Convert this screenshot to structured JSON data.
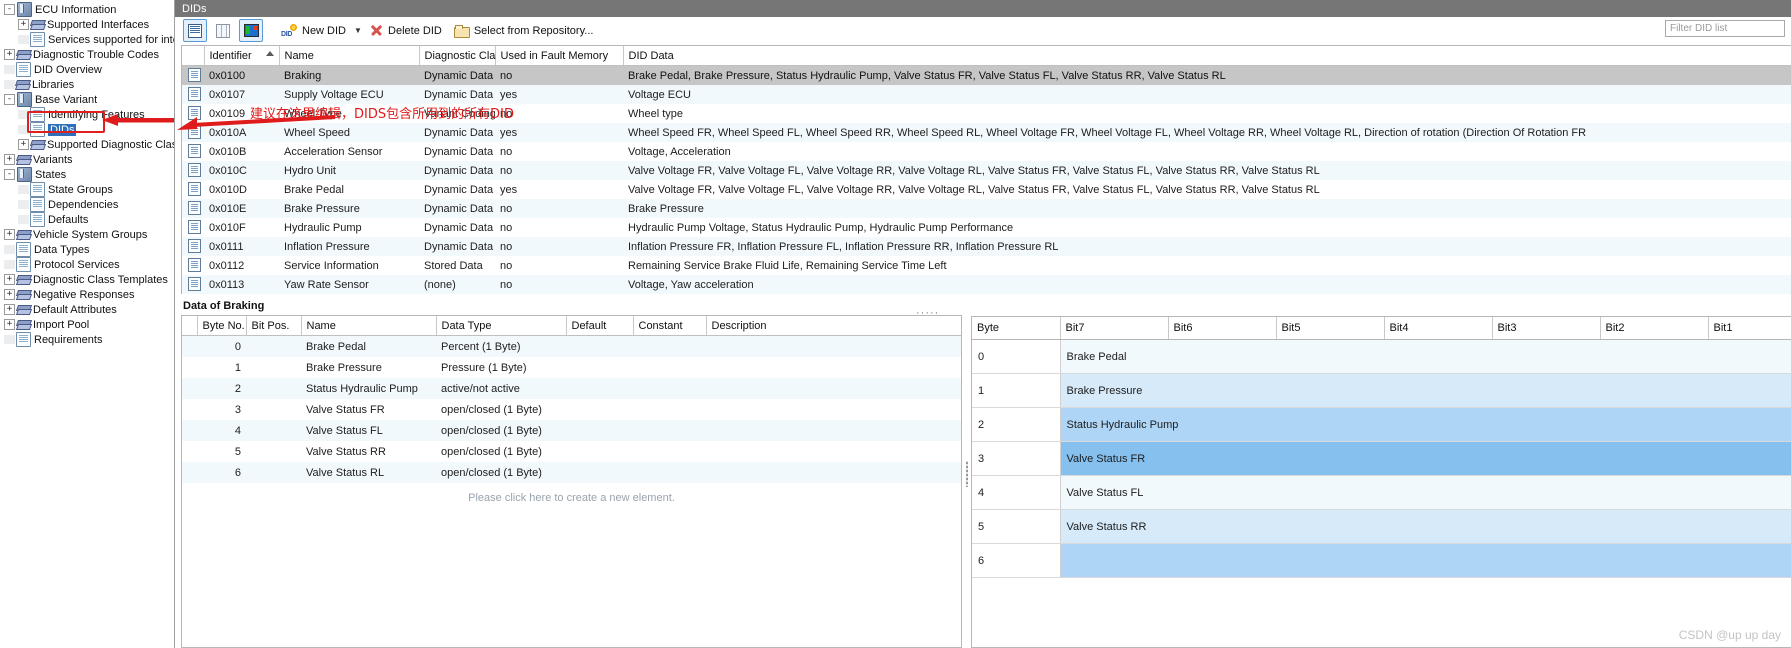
{
  "window": {
    "title": "DIDs"
  },
  "tree": {
    "items": [
      {
        "label": "ECU Information",
        "depth": 0,
        "icon": "book-icon",
        "expander": "-",
        "type": "book"
      },
      {
        "label": "Supported Interfaces",
        "depth": 1,
        "icon": "layer-icon",
        "expander": "+",
        "type": "layer"
      },
      {
        "label": "Services supported for interfa",
        "depth": 1,
        "icon": "page-icon",
        "expander": "",
        "type": "page"
      },
      {
        "label": "Diagnostic Trouble Codes",
        "depth": 0,
        "icon": "layer-icon",
        "expander": "+",
        "type": "layer"
      },
      {
        "label": "DID Overview",
        "depth": 0,
        "icon": "page-icon",
        "expander": "",
        "type": "page"
      },
      {
        "label": "Libraries",
        "depth": 0,
        "icon": "layer-icon",
        "expander": "",
        "type": "layer"
      },
      {
        "label": "Base Variant",
        "depth": 0,
        "icon": "book-icon",
        "expander": "-",
        "type": "book"
      },
      {
        "label": "Identifying Features",
        "depth": 1,
        "icon": "page-icon",
        "expander": "",
        "type": "page"
      },
      {
        "label": "DIDs",
        "depth": 1,
        "icon": "page-icon",
        "expander": "",
        "type": "page",
        "selected": true
      },
      {
        "label": "Supported Diagnostic Classes",
        "depth": 1,
        "icon": "layer-icon",
        "expander": "+",
        "type": "layer"
      },
      {
        "label": "Variants",
        "depth": 0,
        "icon": "layer-icon",
        "expander": "+",
        "type": "layer"
      },
      {
        "label": "States",
        "depth": 0,
        "icon": "book-icon",
        "expander": "-",
        "type": "book"
      },
      {
        "label": "State Groups",
        "depth": 1,
        "icon": "page-icon",
        "expander": "",
        "type": "page"
      },
      {
        "label": "Dependencies",
        "depth": 1,
        "icon": "page-icon",
        "expander": "",
        "type": "page"
      },
      {
        "label": "Defaults",
        "depth": 1,
        "icon": "page-icon",
        "expander": "",
        "type": "page"
      },
      {
        "label": "Vehicle System Groups",
        "depth": 0,
        "icon": "layer-icon",
        "expander": "+",
        "type": "layer"
      },
      {
        "label": "Data Types",
        "depth": 0,
        "icon": "page-icon",
        "expander": "",
        "type": "page"
      },
      {
        "label": "Protocol Services",
        "depth": 0,
        "icon": "page-icon",
        "expander": "",
        "type": "page"
      },
      {
        "label": "Diagnostic Class Templates",
        "depth": 0,
        "icon": "layer-icon",
        "expander": "+",
        "type": "layer"
      },
      {
        "label": "Negative Responses",
        "depth": 0,
        "icon": "layer-icon",
        "expander": "+",
        "type": "layer"
      },
      {
        "label": "Default Attributes",
        "depth": 0,
        "icon": "layer-icon",
        "expander": "+",
        "type": "layer"
      },
      {
        "label": "Import Pool",
        "depth": 0,
        "icon": "layer-icon",
        "expander": "+",
        "type": "layer"
      },
      {
        "label": "Requirements",
        "depth": 0,
        "icon": "page-icon",
        "expander": "",
        "type": "page"
      }
    ]
  },
  "toolbar": {
    "view_list_label": "",
    "view_columns_label": "",
    "view_image_label": "",
    "new_did_label": "New DID",
    "delete_did_label": "Delete DID",
    "select_repository_label": "Select from Repository...",
    "filter_placeholder": "Filter DID list"
  },
  "annotation": {
    "text": "建议在这里编辑，DIDS包含所用到的所有DID",
    "color": "#e01b1b"
  },
  "grid": {
    "columns": [
      "Identifier",
      "Name",
      "Diagnostic Class",
      "Used in Fault Memory",
      "DID Data"
    ],
    "sorted_column": "Identifier",
    "rows": [
      {
        "identifier": "0x0100",
        "name": "Braking",
        "diagnostic_class": "Dynamic Data",
        "used_in_fault_memory": "no",
        "did_data": "Brake Pedal, Brake Pressure, Status Hydraulic Pump, Valve Status FR, Valve Status FL, Valve Status RR, Valve Status RL",
        "selected": true
      },
      {
        "identifier": "0x0107",
        "name": "Supply Voltage ECU",
        "diagnostic_class": "Dynamic Data",
        "used_in_fault_memory": "yes",
        "did_data": "Voltage ECU"
      },
      {
        "identifier": "0x0109",
        "name": "Wheel Type",
        "diagnostic_class": "Variant Coding",
        "used_in_fault_memory": "no",
        "did_data": "Wheel type"
      },
      {
        "identifier": "0x010A",
        "name": "Wheel Speed",
        "diagnostic_class": "Dynamic Data",
        "used_in_fault_memory": "yes",
        "did_data": "Wheel Speed FR, Wheel Speed FL, Wheel Speed RR, Wheel Speed RL, Wheel Voltage FR, Wheel Voltage FL, Wheel Voltage RR, Wheel Voltage RL, Direction of rotation (Direction Of Rotation FR"
      },
      {
        "identifier": "0x010B",
        "name": "Acceleration Sensor",
        "diagnostic_class": "Dynamic Data",
        "used_in_fault_memory": "no",
        "did_data": "Voltage, Acceleration"
      },
      {
        "identifier": "0x010C",
        "name": "Hydro Unit",
        "diagnostic_class": "Dynamic Data",
        "used_in_fault_memory": "no",
        "did_data": "Valve Voltage FR, Valve Voltage FL, Valve Voltage RR, Valve Voltage RL, Valve Status FR, Valve Status FL, Valve Status RR, Valve Status RL"
      },
      {
        "identifier": "0x010D",
        "name": "Brake Pedal",
        "diagnostic_class": "Dynamic Data",
        "used_in_fault_memory": "yes",
        "did_data": "Valve Voltage FR, Valve Voltage FL, Valve Voltage RR, Valve Voltage RL, Valve Status FR, Valve Status FL, Valve Status RR, Valve Status RL"
      },
      {
        "identifier": "0x010E",
        "name": "Brake Pressure",
        "diagnostic_class": "Dynamic Data",
        "used_in_fault_memory": "no",
        "did_data": "Brake Pressure"
      },
      {
        "identifier": "0x010F",
        "name": "Hydraulic Pump",
        "diagnostic_class": "Dynamic Data",
        "used_in_fault_memory": "no",
        "did_data": "Hydraulic Pump Voltage, Status Hydraulic Pump, Hydraulic Pump Performance"
      },
      {
        "identifier": "0x0111",
        "name": "Inflation Pressure",
        "diagnostic_class": "Dynamic Data",
        "used_in_fault_memory": "no",
        "did_data": "Inflation Pressure FR, Inflation Pressure FL, Inflation Pressure RR, Inflation Pressure RL"
      },
      {
        "identifier": "0x0112",
        "name": "Service Information",
        "diagnostic_class": "Stored Data",
        "used_in_fault_memory": "no",
        "did_data": "Remaining Service Brake Fluid Life, Remaining Service Time Left"
      },
      {
        "identifier": "0x0113",
        "name": "Yaw Rate Sensor",
        "diagnostic_class": "(none)",
        "used_in_fault_memory": "no",
        "did_data": "Voltage, Yaw acceleration"
      }
    ],
    "overflow_marker": "·····"
  },
  "detail": {
    "title": "Data of Braking",
    "columns": [
      "Byte No.",
      "Bit Pos.",
      "Name",
      "Data Type",
      "Default",
      "Constant",
      "Description"
    ],
    "rows": [
      {
        "byte_no": "0",
        "bit_pos": "",
        "name": "Brake Pedal",
        "data_type": "Percent (1 Byte)",
        "default": "",
        "constant": "",
        "description": ""
      },
      {
        "byte_no": "1",
        "bit_pos": "",
        "name": "Brake Pressure",
        "data_type": "Pressure (1 Byte)",
        "default": "",
        "constant": "",
        "description": ""
      },
      {
        "byte_no": "2",
        "bit_pos": "",
        "name": "Status Hydraulic Pump",
        "data_type": "active/not active",
        "default": "",
        "constant": "",
        "description": ""
      },
      {
        "byte_no": "3",
        "bit_pos": "",
        "name": "Valve Status FR",
        "data_type": "open/closed (1 Byte)",
        "default": "",
        "constant": "",
        "description": ""
      },
      {
        "byte_no": "4",
        "bit_pos": "",
        "name": "Valve Status FL",
        "data_type": "open/closed (1 Byte)",
        "default": "",
        "constant": "",
        "description": ""
      },
      {
        "byte_no": "5",
        "bit_pos": "",
        "name": "Valve Status RR",
        "data_type": "open/closed (1 Byte)",
        "default": "",
        "constant": "",
        "description": ""
      },
      {
        "byte_no": "6",
        "bit_pos": "",
        "name": "Valve Status RL",
        "data_type": "open/closed (1 Byte)",
        "default": "",
        "constant": "",
        "description": ""
      }
    ],
    "hint": "Please click here to create a new element."
  },
  "bitmap": {
    "columns": [
      "Byte",
      "Bit7",
      "Bit6",
      "Bit5",
      "Bit4",
      "Bit3",
      "Bit2",
      "Bit1"
    ],
    "rows": [
      {
        "byte": "0",
        "label": "Brake Pedal",
        "fill": "#f2f9fc"
      },
      {
        "byte": "1",
        "label": "Brake Pressure",
        "fill": "#d7eaf9"
      },
      {
        "byte": "2",
        "label": "Status Hydraulic Pump",
        "fill": "#aed5f5"
      },
      {
        "byte": "3",
        "label": "Valve Status FR",
        "fill": "#85c0ef"
      },
      {
        "byte": "4",
        "label": "Valve Status FL",
        "fill": "#f2f9fc"
      },
      {
        "byte": "5",
        "label": "Valve Status RR",
        "fill": "#d7eaf9"
      },
      {
        "byte": "6",
        "label": "",
        "fill": "#aed5f5"
      }
    ]
  },
  "watermark": {
    "text": "CSDN @up up day"
  }
}
